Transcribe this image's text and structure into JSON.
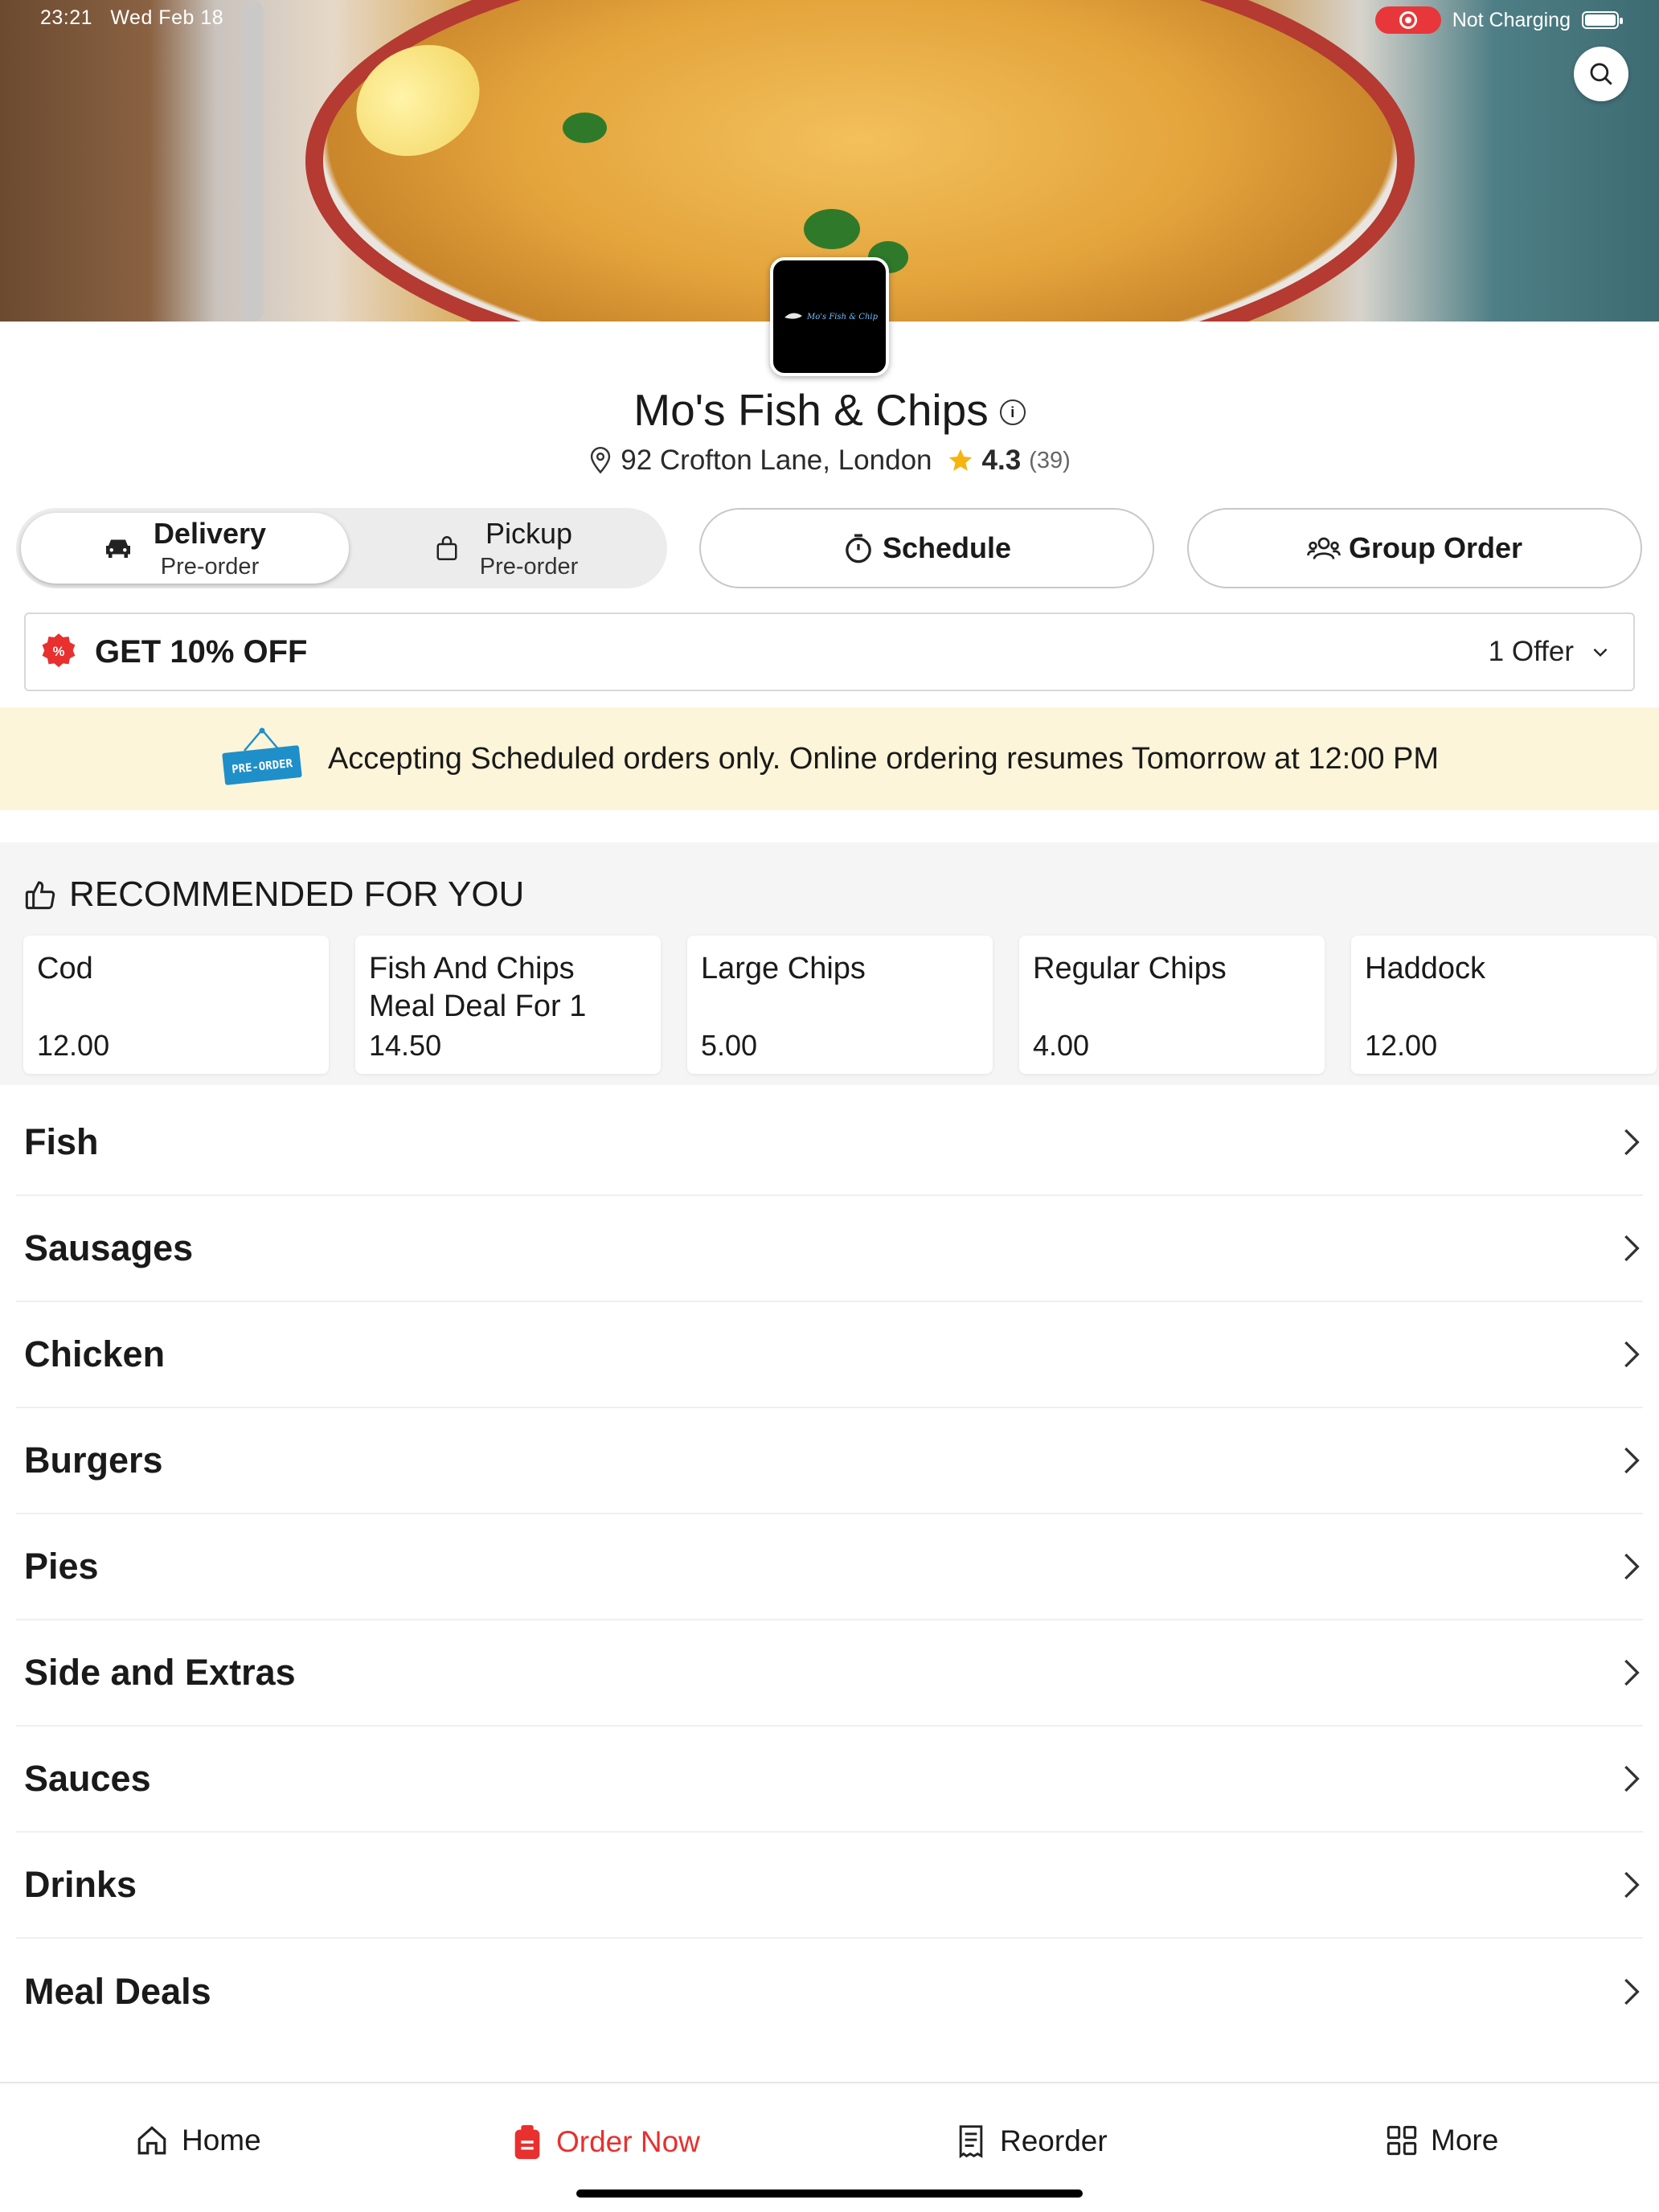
{
  "status_bar": {
    "time": "23:21",
    "date": "Wed Feb 18",
    "charging": "Not Charging"
  },
  "restaurant": {
    "logo_text": "Mo's Fish & Chips",
    "name": "Mo's Fish & Chips",
    "address": "92 Crofton Lane, London",
    "rating": "4.3",
    "rating_count": "(39)"
  },
  "order_mode": {
    "delivery": {
      "label": "Delivery",
      "sub": "Pre-order"
    },
    "pickup": {
      "label": "Pickup",
      "sub": "Pre-order"
    },
    "selected": "delivery"
  },
  "actions": {
    "schedule": "Schedule",
    "group_order": "Group Order"
  },
  "offer": {
    "title": "GET 10% OFF",
    "count": "1 Offer"
  },
  "banner": {
    "badge": "PRE-ORDER",
    "text": "Accepting Scheduled orders only. Online ordering resumes Tomorrow at 12:00 PM"
  },
  "recommended": {
    "title": "RECOMMENDED FOR YOU",
    "items": [
      {
        "name": "Cod",
        "price": "12.00"
      },
      {
        "name": "Fish And Chips Meal Deal For 1",
        "price": "14.50"
      },
      {
        "name": "Large Chips",
        "price": "5.00"
      },
      {
        "name": "Regular Chips",
        "price": "4.00"
      },
      {
        "name": "Haddock",
        "price": "12.00"
      }
    ]
  },
  "categories": [
    "Fish",
    "Sausages",
    "Chicken",
    "Burgers",
    "Pies",
    "Side and Extras",
    "Sauces",
    "Drinks",
    "Meal Deals"
  ],
  "bottom_nav": {
    "home": "Home",
    "order_now": "Order Now",
    "reorder": "Reorder",
    "more": "More",
    "active": "order_now"
  },
  "colors": {
    "accent": "#e8302f",
    "banner_bg": "#fdf5d9",
    "star": "#f6b40e",
    "preorder_badge": "#1f8fc9"
  }
}
